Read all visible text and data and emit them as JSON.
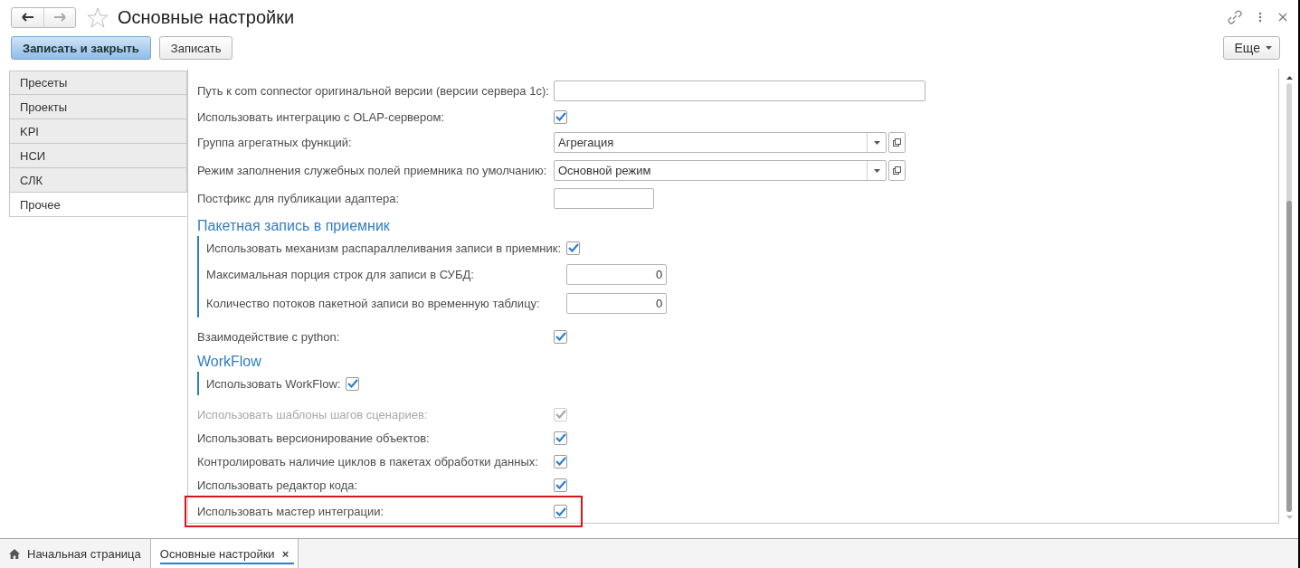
{
  "window": {
    "title": "Основные настройки"
  },
  "toolbar": {
    "buttons": [
      {
        "label": "Записать и закрыть",
        "kind": "primary"
      },
      {
        "label": "Записать",
        "kind": "normal"
      }
    ],
    "more": {
      "label": "Еще"
    }
  },
  "sidebar": {
    "tabs": [
      {
        "label": "Пресеты",
        "selected": false
      },
      {
        "label": "Проекты",
        "selected": false
      },
      {
        "label": "KPI",
        "selected": false
      },
      {
        "label": "НСИ",
        "selected": false
      },
      {
        "label": "СЛК",
        "selected": false
      },
      {
        "label": "Прочее",
        "selected": true
      }
    ]
  },
  "form": {
    "items": [
      {
        "kind": "text",
        "label": "Путь к com connector оригинальной версии (версии сервера 1с):",
        "highlighted": false
      },
      {
        "kind": "checkbox",
        "label": "Использовать интеграцию с OLAP-сервером:",
        "checked": true,
        "disabled": false,
        "highlighted": false
      },
      {
        "kind": "select",
        "label": "Группа агрегатных функций:",
        "value": "Агрегация",
        "highlighted": false
      },
      {
        "kind": "select",
        "label": "Режим заполнения служебных полей приемника по умолчанию:",
        "value": "Основной режим",
        "highlighted": false
      },
      {
        "kind": "short",
        "label": "Постфикс для публикации адаптера:",
        "highlighted": false
      },
      {
        "kind": "group",
        "title": "Пакетная запись в приемник",
        "highlighted": false,
        "children": [
          {
            "kind": "checkbox",
            "label": "Использовать механизм распараллеливания записи в приемник:",
            "checked": true,
            "disabled": false
          },
          {
            "kind": "number",
            "label": "Максимальная порция строк для записи в СУБД:",
            "value": "0"
          },
          {
            "kind": "number",
            "label": "Количество потоков пакетной записи во временную таблицу:",
            "value": "0"
          }
        ]
      },
      {
        "kind": "checkbox",
        "label": "Взаимодействие с python:",
        "checked": true,
        "disabled": false,
        "highlighted": false
      },
      {
        "kind": "group",
        "title": "WorkFlow",
        "highlighted": false,
        "children": [
          {
            "kind": "checkbox",
            "label": "Использовать WorkFlow:",
            "checked": true,
            "disabled": false
          }
        ]
      },
      {
        "kind": "checkbox",
        "label": "Использовать шаблоны шагов сценариев:",
        "checked": true,
        "disabled": true,
        "highlighted": false
      },
      {
        "kind": "checkbox",
        "label": "Использовать версионирование объектов:",
        "checked": true,
        "disabled": false,
        "highlighted": false
      },
      {
        "kind": "checkbox",
        "label": "Контролировать наличие циклов в пакетах обработки данных:",
        "checked": true,
        "disabled": false,
        "highlighted": false
      },
      {
        "kind": "checkbox",
        "label": "Использовать редактор кода:",
        "checked": true,
        "disabled": false,
        "highlighted": false
      },
      {
        "kind": "checkbox",
        "label": "Использовать мастер интеграции:",
        "checked": true,
        "disabled": false,
        "highlighted": true
      }
    ]
  },
  "taskbar": {
    "tabs": [
      {
        "label": "Начальная страница",
        "kind": "home",
        "selected": false
      },
      {
        "label": "Основные настройки",
        "kind": "document",
        "selected": true,
        "close": "×"
      }
    ]
  }
}
